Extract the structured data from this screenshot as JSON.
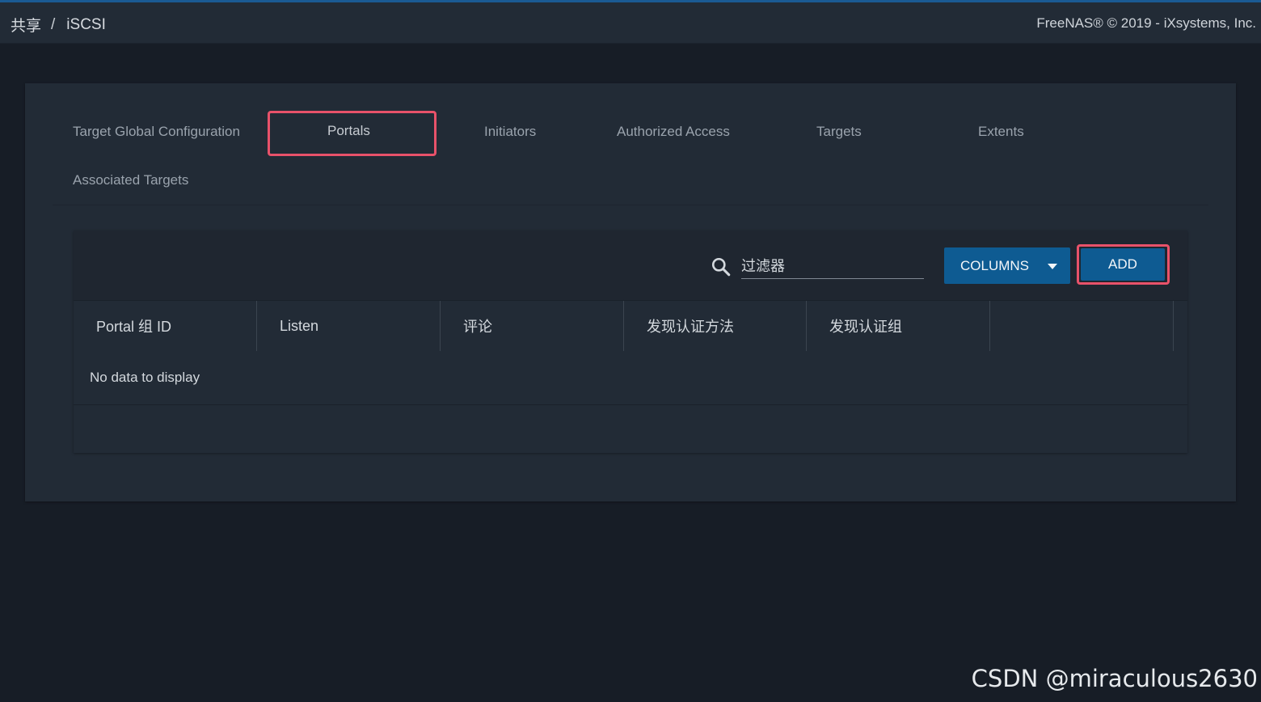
{
  "header": {
    "breadcrumb": [
      "共享",
      "iSCSI"
    ],
    "breadcrumb_separator": "/",
    "copyright": "FreeNAS® © 2019 - iXsystems, Inc."
  },
  "tabs": [
    {
      "label": "Target Global Configuration",
      "active": false
    },
    {
      "label": "Portals",
      "active": true
    },
    {
      "label": "Initiators",
      "active": false
    },
    {
      "label": "Authorized Access",
      "active": false
    },
    {
      "label": "Targets",
      "active": false
    },
    {
      "label": "Extents",
      "active": false
    },
    {
      "label": "Associated Targets",
      "active": false
    }
  ],
  "toolbar": {
    "filter_placeholder": "过滤器",
    "columns_label": "COLUMNS",
    "add_label": "ADD"
  },
  "table": {
    "columns": [
      "Portal 组 ID",
      "Listen",
      "评论",
      "发现认证方法",
      "发现认证组",
      ""
    ],
    "empty_message": "No data to display"
  },
  "watermark": "CSDN @miraculous2630",
  "colors": {
    "accent": "#0e5b92",
    "highlight": "#e8526a",
    "background": "#171d26",
    "panel": "#222b36"
  }
}
